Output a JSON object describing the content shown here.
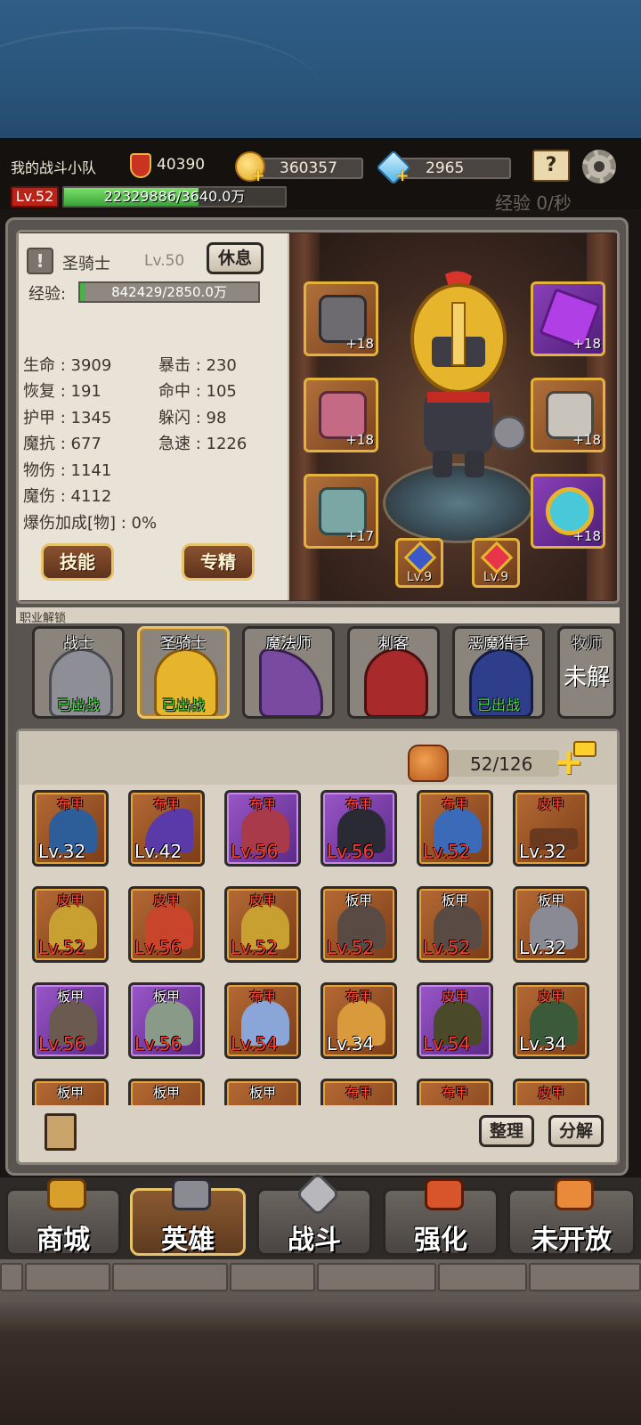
{
  "top_bar": {
    "team_name": "我的战斗小队",
    "power": "40390",
    "gold": "360357",
    "gems": "2965",
    "player_level": "Lv.52",
    "player_exp": "22329886/3640.0万",
    "player_exp_fraction": 0.61,
    "exp_rate": "经验 0/秒"
  },
  "hero": {
    "name": "圣骑士",
    "level": "Lv.50",
    "rest_label": "休息",
    "exp_label": "经验:",
    "exp_value": "842429/2850.0万",
    "exp_fraction": 0.03,
    "stats_left": [
      "生命 : 3909",
      "恢复 : 191",
      "护甲 : 1345",
      "魔抗 : 677",
      "物伤 : 1141",
      "魔伤 : 4112",
      "爆伤加成[物] : 0%"
    ],
    "stats_right": [
      "暴击 : 230",
      "命中 : 105",
      "躲闪 : 98",
      "急速 : 1226"
    ],
    "skill_label": "技能",
    "mastery_label": "专精"
  },
  "equipment": {
    "helmet_plus": "+18",
    "armor_plus": "+18",
    "boots_plus": "+17",
    "star_plus": "+18",
    "glove_plus": "+18",
    "ring_plus": "+18",
    "gem1_level": "Lv.9",
    "gem2_level": "Lv.9"
  },
  "classes": {
    "title": "职业解锁",
    "items": [
      {
        "name": "战士",
        "status": "已出战"
      },
      {
        "name": "圣骑士",
        "status": "已出战"
      },
      {
        "name": "魔法师",
        "status": ""
      },
      {
        "name": "刺客",
        "status": ""
      },
      {
        "name": "恶魔猎手",
        "status": "已出战"
      },
      {
        "name": "牧师",
        "status": "未解"
      }
    ]
  },
  "inventory": {
    "capacity": "52/126",
    "rows": [
      [
        {
          "type": "布甲",
          "level": "Lv.32"
        },
        {
          "type": "布甲",
          "level": "Lv.42"
        },
        {
          "type": "布甲",
          "level": "Lv.56"
        },
        {
          "type": "布甲",
          "level": "Lv.56"
        },
        {
          "type": "布甲",
          "level": "Lv.52"
        },
        {
          "type": "皮甲",
          "level": "Lv.32"
        }
      ],
      [
        {
          "type": "皮甲",
          "level": "Lv.52"
        },
        {
          "type": "皮甲",
          "level": "Lv.56"
        },
        {
          "type": "皮甲",
          "level": "Lv.52"
        },
        {
          "type": "板甲",
          "level": "Lv.52"
        },
        {
          "type": "板甲",
          "level": "Lv.52"
        },
        {
          "type": "板甲",
          "level": "Lv.32"
        }
      ],
      [
        {
          "type": "板甲",
          "level": "Lv.56"
        },
        {
          "type": "板甲",
          "level": "Lv.56"
        },
        {
          "type": "布甲",
          "level": "Lv.54"
        },
        {
          "type": "布甲",
          "level": "Lv.34"
        },
        {
          "type": "皮甲",
          "level": "Lv.54"
        },
        {
          "type": "皮甲",
          "level": "Lv.34"
        }
      ],
      [
        {
          "type": "板甲",
          "level": ""
        },
        {
          "type": "板甲",
          "level": ""
        },
        {
          "type": "板甲",
          "level": ""
        },
        {
          "type": "布甲",
          "level": ""
        },
        {
          "type": "布甲",
          "level": ""
        },
        {
          "type": "皮甲",
          "level": ""
        }
      ]
    ],
    "sort_label": "整理",
    "decompose_label": "分解"
  },
  "nav": {
    "shop": "商城",
    "hero": "英雄",
    "battle": "战斗",
    "upgrade": "强化",
    "locked": "未开放"
  },
  "colors": {
    "gold_border": "#e3b23c",
    "exp_green": "#47b245",
    "deployed_green": "#4fe04a",
    "red_level": "#ff3b2f"
  }
}
